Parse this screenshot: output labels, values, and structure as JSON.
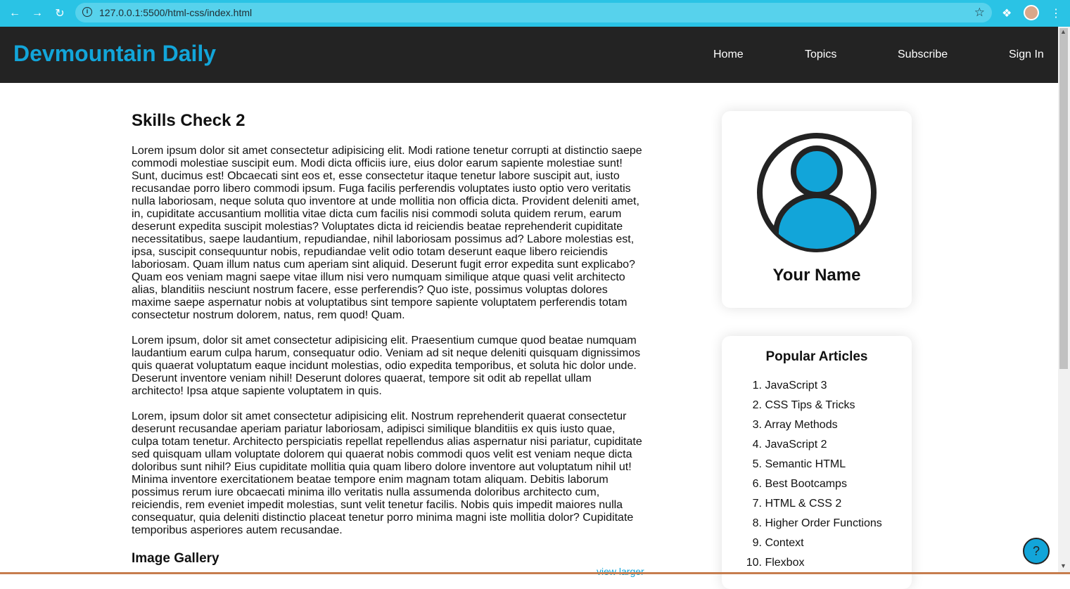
{
  "browser": {
    "url": "127.0.0.1:5500/html-css/index.html",
    "back_icon": "arrow-left-icon",
    "forward_icon": "arrow-right-icon",
    "reload_icon": "reload-icon"
  },
  "site": {
    "logo": "Devmountain Daily",
    "nav": [
      "Home",
      "Topics",
      "Subscribe",
      "Sign In"
    ]
  },
  "article": {
    "title": "Skills Check 2",
    "paragraphs": [
      "Lorem ipsum dolor sit amet consectetur adipisicing elit. Modi ratione tenetur corrupti at distinctio saepe commodi molestiae suscipit eum. Modi dicta officiis iure, eius dolor earum sapiente molestiae sunt! Sunt, ducimus est! Obcaecati sint eos et, esse consectetur itaque tenetur labore suscipit aut, iusto recusandae porro libero commodi ipsum. Fuga facilis perferendis voluptates iusto optio vero veritatis nulla laboriosam, neque soluta quo inventore at unde mollitia non officia dicta. Provident deleniti amet, in, cupiditate accusantium mollitia vitae dicta cum facilis nisi commodi soluta quidem rerum, earum deserunt expedita suscipit molestias? Voluptates dicta id reiciendis beatae reprehenderit cupiditate necessitatibus, saepe laudantium, repudiandae, nihil laboriosam possimus ad? Labore molestias est, ipsa, suscipit consequuntur nobis, repudiandae velit odio totam deserunt eaque libero reiciendis laboriosam. Quam illum natus cum aperiam sint aliquid. Deserunt fugit error expedita sunt explicabo? Quam eos veniam magni saepe vitae illum nisi vero numquam similique atque quasi velit architecto alias, blanditiis nesciunt nostrum facere, esse perferendis? Quo iste, possimus voluptas dolores maxime saepe aspernatur nobis at voluptatibus sint tempore sapiente voluptatem perferendis totam consectetur nostrum dolorem, natus, rem quod! Quam.",
      "Lorem ipsum, dolor sit amet consectetur adipisicing elit. Praesentium cumque quod beatae numquam laudantium earum culpa harum, consequatur odio. Veniam ad sit neque deleniti quisquam dignissimos quis quaerat voluptatum eaque incidunt molestias, odio expedita temporibus, et soluta hic dolor unde. Deserunt inventore veniam nihil! Deserunt dolores quaerat, tempore sit odit ab repellat ullam architecto! Ipsa atque sapiente voluptatem in quis.",
      "Lorem, ipsum dolor sit amet consectetur adipisicing elit. Nostrum reprehenderit quaerat consectetur deserunt recusandae aperiam pariatur laboriosam, adipisci similique blanditiis ex quis iusto quae, culpa totam tenetur. Architecto perspiciatis repellat repellendus alias aspernatur nisi pariatur, cupiditate sed quisquam ullam voluptate dolorem qui quaerat nobis commodi quos velit est veniam neque dicta doloribus sunt nihil? Eius cupiditate mollitia quia quam libero dolore inventore aut voluptatum nihil ut! Minima inventore exercitationem beatae tempore enim magnam totam aliquam. Debitis laborum possimus rerum iure obcaecati minima illo veritatis nulla assumenda doloribus architecto cum, reiciendis, rem eveniet impedit molestias, sunt velit tenetur facilis. Nobis quis impedit maiores nulla consequatur, quia deleniti distinctio placeat tenetur porro minima magni iste mollitia dolor? Cupiditate temporibus asperiores autem recusandae."
    ],
    "gallery_title": "Image Gallery",
    "view_larger": "view larger"
  },
  "profile": {
    "name": "Your Name",
    "avatar_icon": "user-avatar-icon"
  },
  "popular": {
    "title": "Popular Articles",
    "items": [
      {
        "num": "1.",
        "label": "JavaScript 3"
      },
      {
        "num": "2.",
        "label": "CSS Tips & Tricks"
      },
      {
        "num": "3.",
        "label": "Array Methods"
      },
      {
        "num": "4.",
        "label": "JavaScript 2"
      },
      {
        "num": "5.",
        "label": "Semantic HTML"
      },
      {
        "num": "6.",
        "label": "Best Bootcamps"
      },
      {
        "num": "7.",
        "label": "HTML & CSS 2"
      },
      {
        "num": "8.",
        "label": "Higher Order Functions"
      },
      {
        "num": "9.",
        "label": "Context"
      },
      {
        "num": "10.",
        "label": "Flexbox"
      }
    ]
  },
  "help": {
    "label": "?"
  },
  "colors": {
    "accent": "#12a5d9",
    "header_bg": "#232323",
    "chrome_bg": "#2ac3e5"
  }
}
